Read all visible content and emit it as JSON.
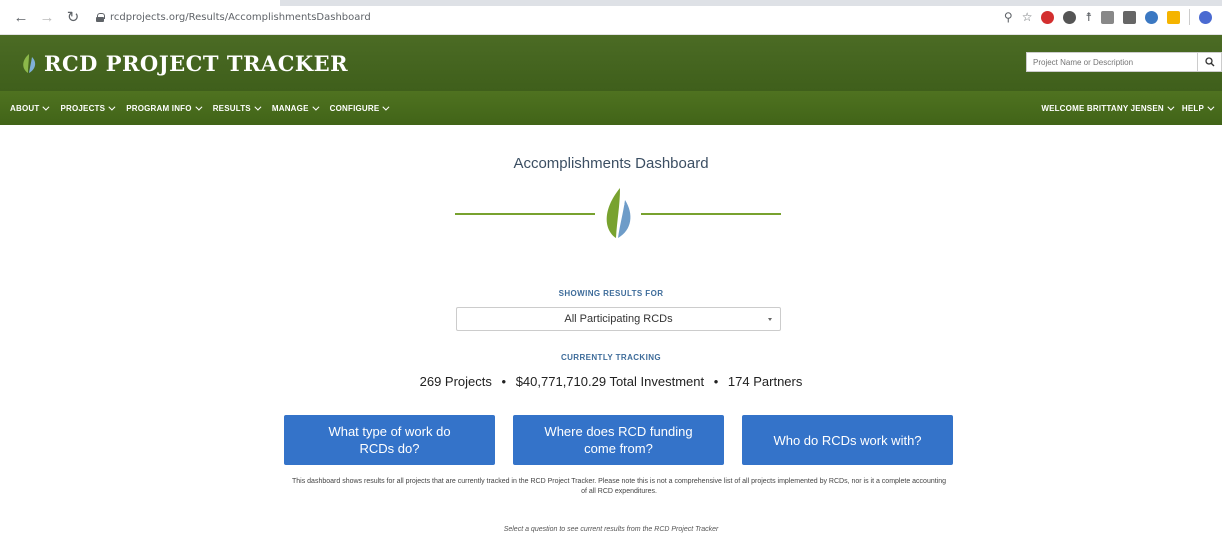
{
  "browser": {
    "url": "rcdprojects.org/Results/AccomplishmentsDashboard"
  },
  "site": {
    "title": "RCD PROJECT TRACKER",
    "search_placeholder": "Project Name or Description"
  },
  "nav": {
    "left": [
      "ABOUT",
      "PROJECTS",
      "PROGRAM INFO",
      "RESULTS",
      "MANAGE",
      "CONFIGURE"
    ],
    "welcome": "WELCOME BRITTANY JENSEN",
    "help": "HELP"
  },
  "dashboard": {
    "title": "Accomplishments Dashboard",
    "showing_label": "SHOWING RESULTS FOR",
    "selected_rcd": "All Participating RCDs",
    "tracking_label": "CURRENTLY TRACKING",
    "projects": "269 Projects",
    "investment": "$40,771,710.29 Total Investment",
    "partners": "174 Partners",
    "stat_separator": "•",
    "questions": [
      "What type of work do RCDs do?",
      "Where does RCD funding come from?",
      "Who do RCDs work with?"
    ],
    "disclaimer": "This dashboard shows results for all projects that are currently tracked in the RCD Project Tracker. Please note this is not a comprehensive list of all projects implemented by RCDs, nor is it a complete accounting of all RCD expenditures.",
    "hint": "Select a question to see current results from the RCD Project Tracker"
  },
  "colors": {
    "header_green": "#3f5f1b",
    "accent_green": "#78a22f",
    "button_blue": "#3473c9",
    "title_text": "#3c4f63"
  }
}
